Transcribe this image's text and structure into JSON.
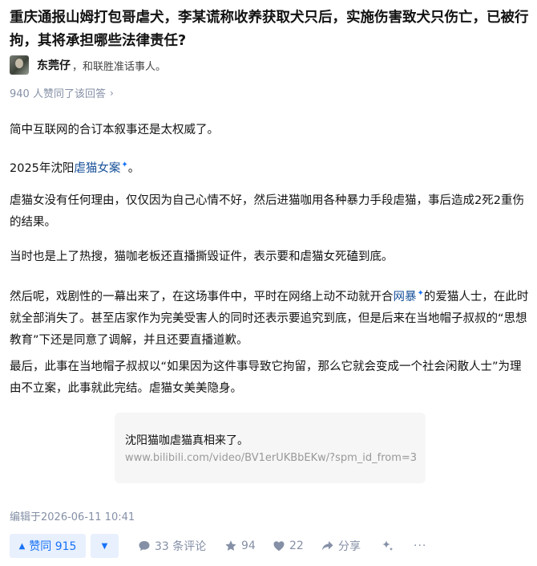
{
  "question": {
    "title": "重庆通报山姆打包哥虐犬，李某谎称收养获取犬只后，实施伤害致犬只伤亡，已被行拘，其将承担哪些法律责任?"
  },
  "author": {
    "name": "东莞仔",
    "bio": "，和联胜准话事人。"
  },
  "likes_note": {
    "text": "940 人赞同了该回答",
    "chevron": "›"
  },
  "content": {
    "p1": "简中互联网的合订本叙事还是太权威了。",
    "p2_prefix": "2025年沈阳",
    "p2_link": "虐猫女案",
    "p2_suffix": "。",
    "p3": "虐猫女没有任何理由，仅仅因为自己心情不好，然后进猫咖用各种暴力手段虐猫，事后造成2死2重伤的结果。",
    "p4": "当时也是上了热搜，猫咖老板还直播撕毁证件，表示要和虐猫女死磕到底。",
    "p5_prefix": "然后呢，戏剧性的一幕出来了，在这场事件中，平时在网络上动不动就开合",
    "p5_link": "网暴",
    "p5_suffix": "的爱猫人士，在此时就全部消失了。甚至店家作为完美受害人的同时还表示要追究到底，但是后来在当地帽子叔叔的“思想教育”下还是同意了调解，并且还要直播道歉。",
    "p6": "最后，此事在当地帽子叔叔以“如果因为这件事导致它拘留，那么它就会变成一个社会闲散人士”为理由不立案，此事就此完结。虐猫女美美隐身。",
    "spark_icon": "✦"
  },
  "link_card": {
    "title": "沈阳猫咖虐猫真相来了。",
    "url": "www.bilibili.com/video/BV1erUKBbEKw/?spm_id_from=3..."
  },
  "edit_note": "编辑于2026-06-11 10:41",
  "toolbar": {
    "vote_up_label": "赞同 915",
    "vote_up_icon": "▲",
    "vote_down_icon": "▼",
    "comments_label": "33 条评论",
    "favorites_count": "94",
    "likes_count": "22",
    "share_label": "分享",
    "ai_icon": "sparkle-icon",
    "more_label": "···",
    "accent_color": "#1772f6"
  }
}
